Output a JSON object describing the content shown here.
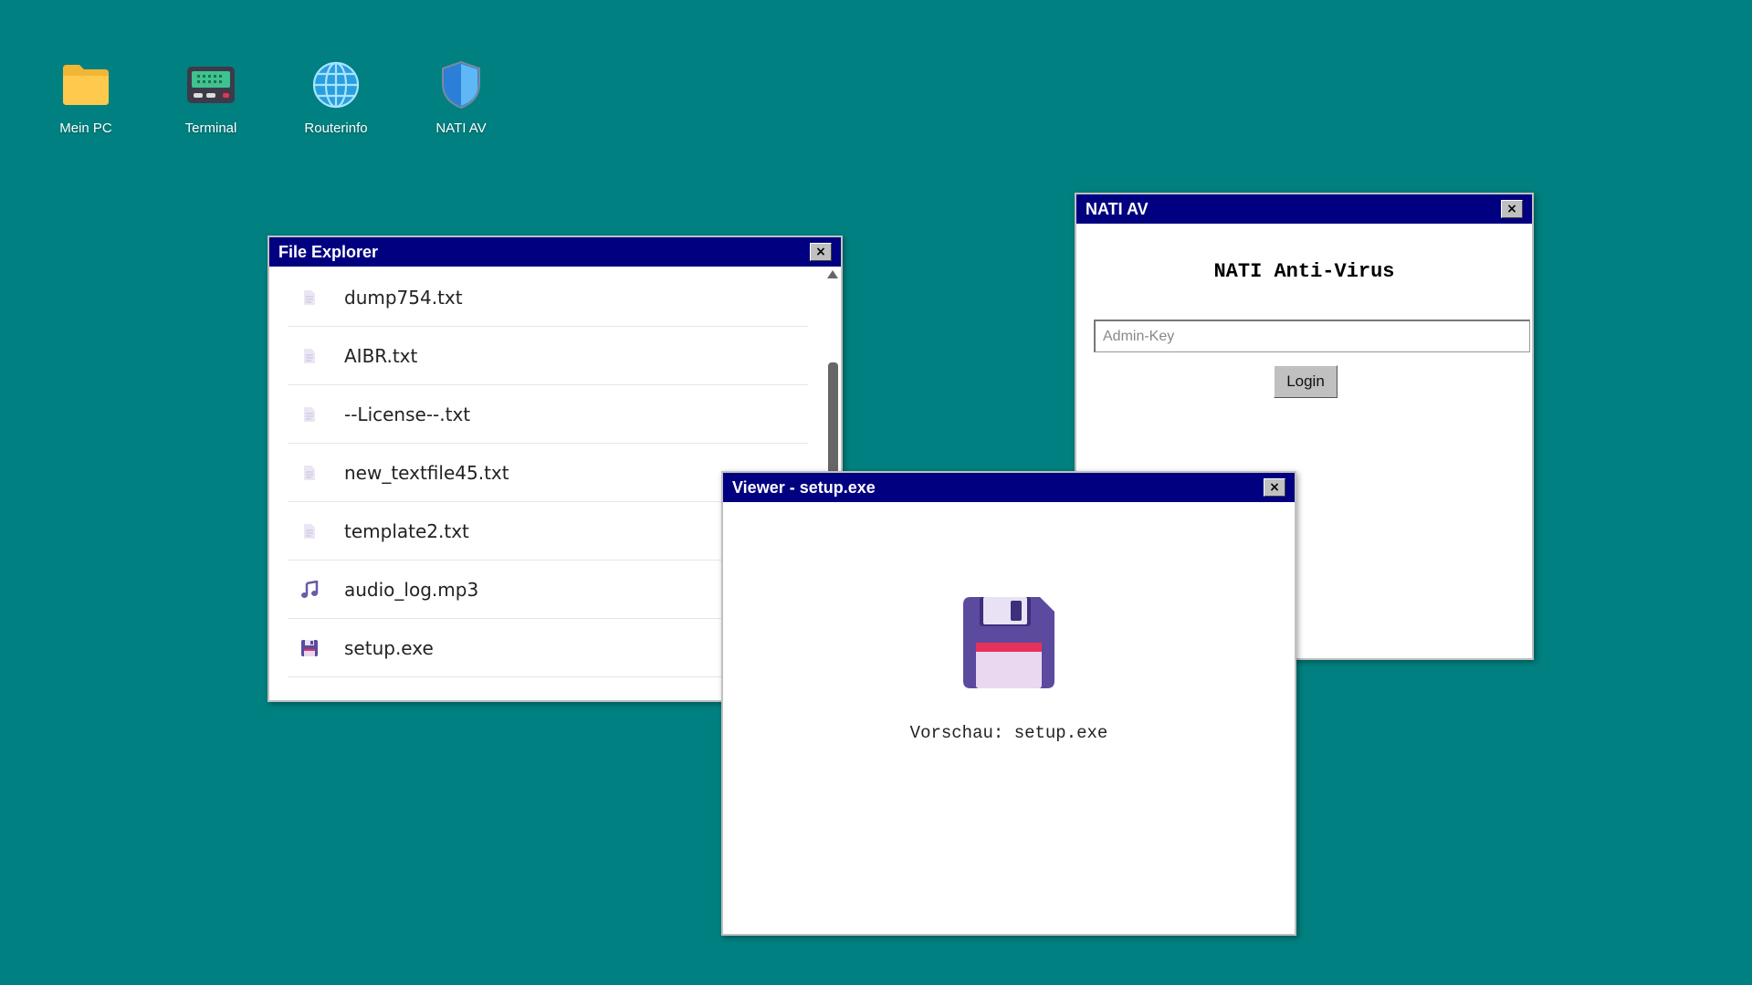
{
  "desktop": {
    "background": "#008080",
    "icons": [
      {
        "label": "Mein PC",
        "icon": "folder-icon"
      },
      {
        "label": "Terminal",
        "icon": "terminal-icon"
      },
      {
        "label": "Routerinfo",
        "icon": "globe-icon"
      },
      {
        "label": "NATI AV",
        "icon": "shield-icon"
      }
    ]
  },
  "explorer": {
    "title": "File Explorer",
    "close": "×",
    "files": [
      {
        "name": "dump754.txt",
        "icon": "text-file-icon"
      },
      {
        "name": "AIBR.txt",
        "icon": "text-file-icon"
      },
      {
        "name": "--License--.txt",
        "icon": "text-file-icon"
      },
      {
        "name": "new_textfile45.txt",
        "icon": "text-file-icon"
      },
      {
        "name": "template2.txt",
        "icon": "text-file-icon"
      },
      {
        "name": "audio_log.mp3",
        "icon": "music-note-icon"
      },
      {
        "name": "setup.exe",
        "icon": "floppy-disk-icon"
      }
    ]
  },
  "nati": {
    "title": "NATI AV",
    "close": "×",
    "heading": "NATI Anti-Virus",
    "input_placeholder": "Admin-Key",
    "login_label": "Login"
  },
  "viewer": {
    "title": "Viewer - setup.exe",
    "close": "×",
    "icon": "floppy-disk-icon",
    "caption": "Vorschau: setup.exe"
  },
  "colors": {
    "titlebar": "#000080",
    "floppy": "#5b4a9e"
  }
}
